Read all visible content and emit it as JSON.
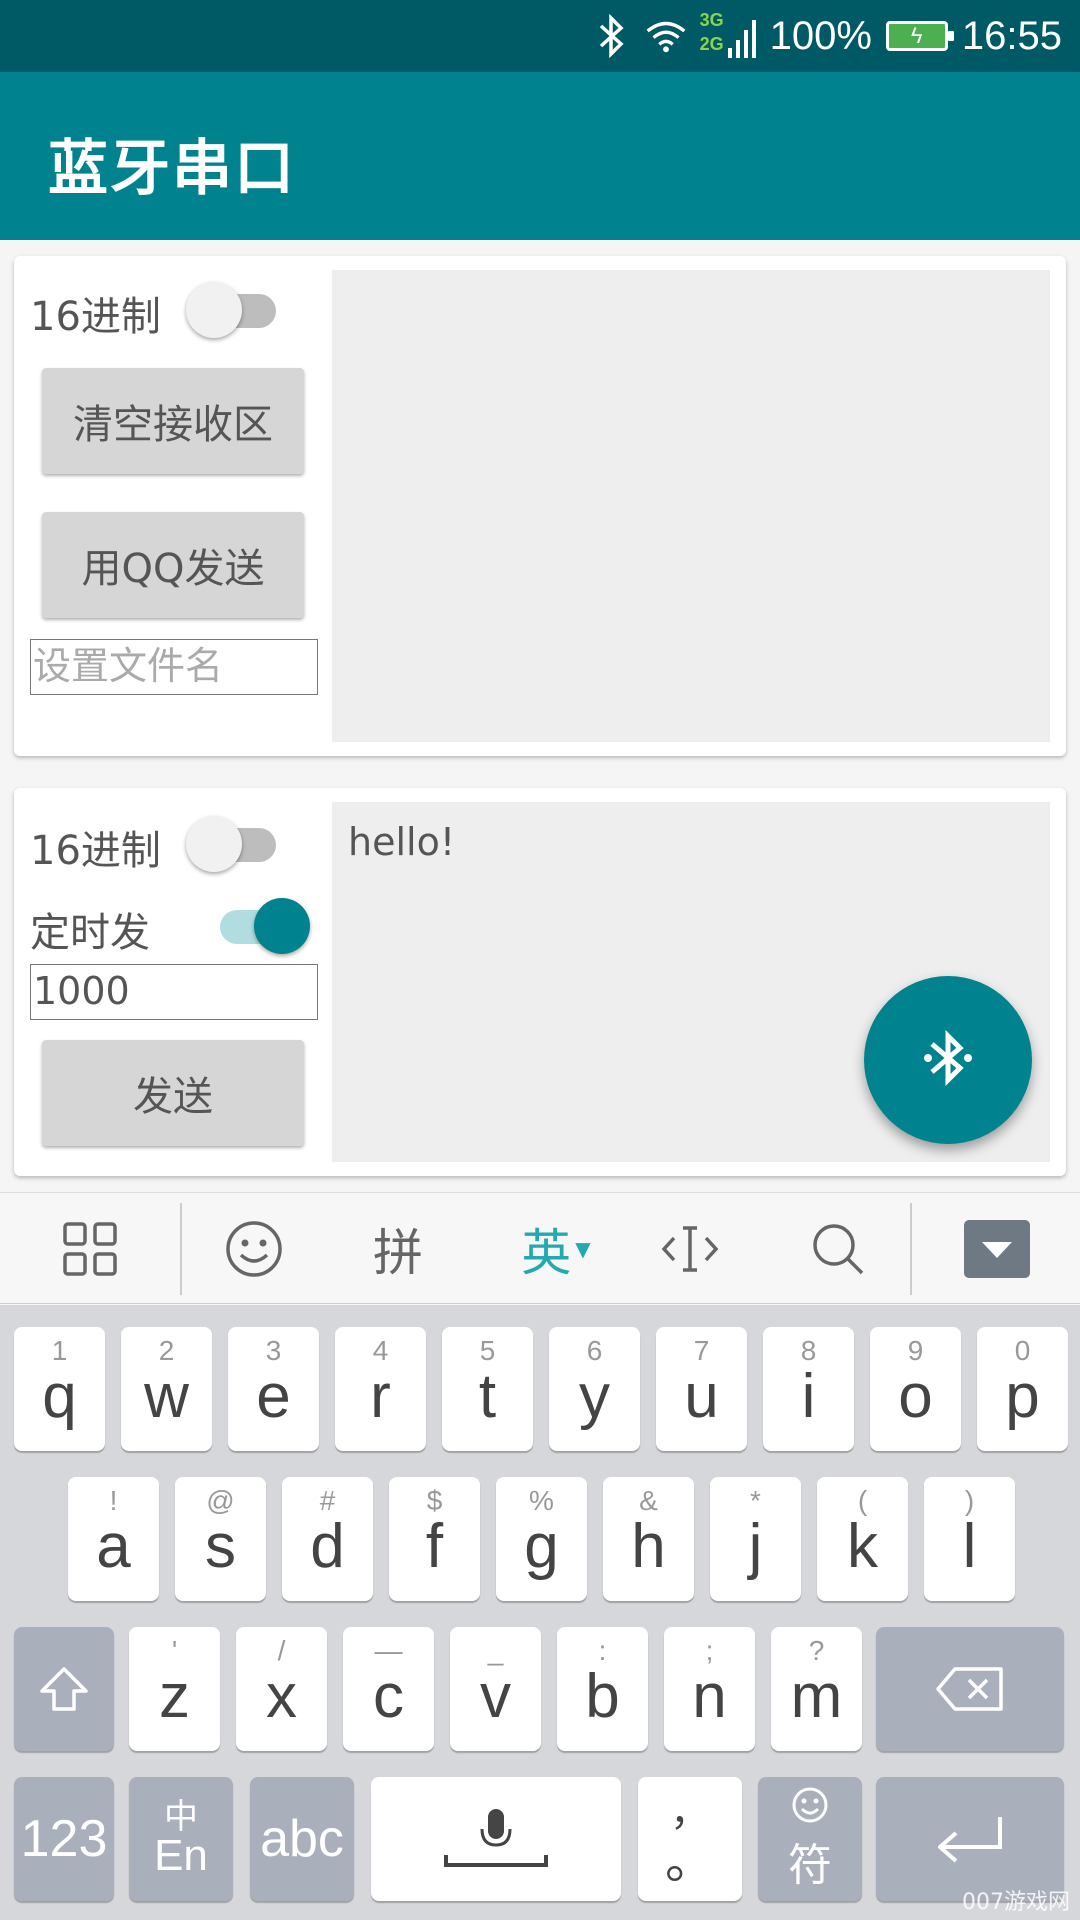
{
  "status_bar": {
    "net_3g": "3G",
    "net_2g": "2G",
    "battery_pct": "100%",
    "time": "16:55"
  },
  "app_bar": {
    "title": "蓝牙串口"
  },
  "receive_panel": {
    "hex_label": "16进制",
    "hex_on": false,
    "clear_button": "清空接收区",
    "qq_send_button": "用QQ发送",
    "filename_placeholder": "设置文件名",
    "receive_text": ""
  },
  "send_panel": {
    "hex_label": "16进制",
    "hex_on": false,
    "timer_label": "定时发",
    "timer_on": true,
    "interval_value": "1000",
    "send_button": "发送",
    "send_text": "hello!"
  },
  "fab": {
    "icon": "bluetooth-searching-icon"
  },
  "ime_toolbar": {
    "items": [
      {
        "name": "grid-icon",
        "label": ""
      },
      {
        "name": "emoji-icon",
        "label": ""
      },
      {
        "name": "pinyin",
        "label": "拼"
      },
      {
        "name": "english",
        "label": "英"
      },
      {
        "name": "cursor-icon",
        "label": ""
      },
      {
        "name": "search-icon",
        "label": ""
      },
      {
        "name": "hide-keyboard-icon",
        "label": ""
      }
    ]
  },
  "keyboard": {
    "row1": [
      {
        "main": "q",
        "sub": "1"
      },
      {
        "main": "w",
        "sub": "2"
      },
      {
        "main": "e",
        "sub": "3"
      },
      {
        "main": "r",
        "sub": "4"
      },
      {
        "main": "t",
        "sub": "5"
      },
      {
        "main": "y",
        "sub": "6"
      },
      {
        "main": "u",
        "sub": "7"
      },
      {
        "main": "i",
        "sub": "8"
      },
      {
        "main": "o",
        "sub": "9"
      },
      {
        "main": "p",
        "sub": "0"
      }
    ],
    "row2": [
      {
        "main": "a",
        "sub": "!"
      },
      {
        "main": "s",
        "sub": "@"
      },
      {
        "main": "d",
        "sub": "#"
      },
      {
        "main": "f",
        "sub": "$"
      },
      {
        "main": "g",
        "sub": "%"
      },
      {
        "main": "h",
        "sub": "&"
      },
      {
        "main": "j",
        "sub": "*"
      },
      {
        "main": "k",
        "sub": "("
      },
      {
        "main": "l",
        "sub": ")"
      }
    ],
    "row3": [
      {
        "main": "z",
        "sub": "'"
      },
      {
        "main": "x",
        "sub": "/"
      },
      {
        "main": "c",
        "sub": "—"
      },
      {
        "main": "v",
        "sub": "_"
      },
      {
        "main": "b",
        "sub": ":"
      },
      {
        "main": "n",
        "sub": ";"
      },
      {
        "main": "m",
        "sub": "?"
      }
    ],
    "num_key": "123",
    "lang_top": "中",
    "lang_bottom": "En",
    "abc_key": "abc",
    "punct_top": "，",
    "punct_bottom": "。",
    "symbol_key": "符"
  },
  "watermark": "007游戏网",
  "colors": {
    "primary": "#00838F",
    "status_bar": "#005A65",
    "accent": "#22aab0"
  }
}
